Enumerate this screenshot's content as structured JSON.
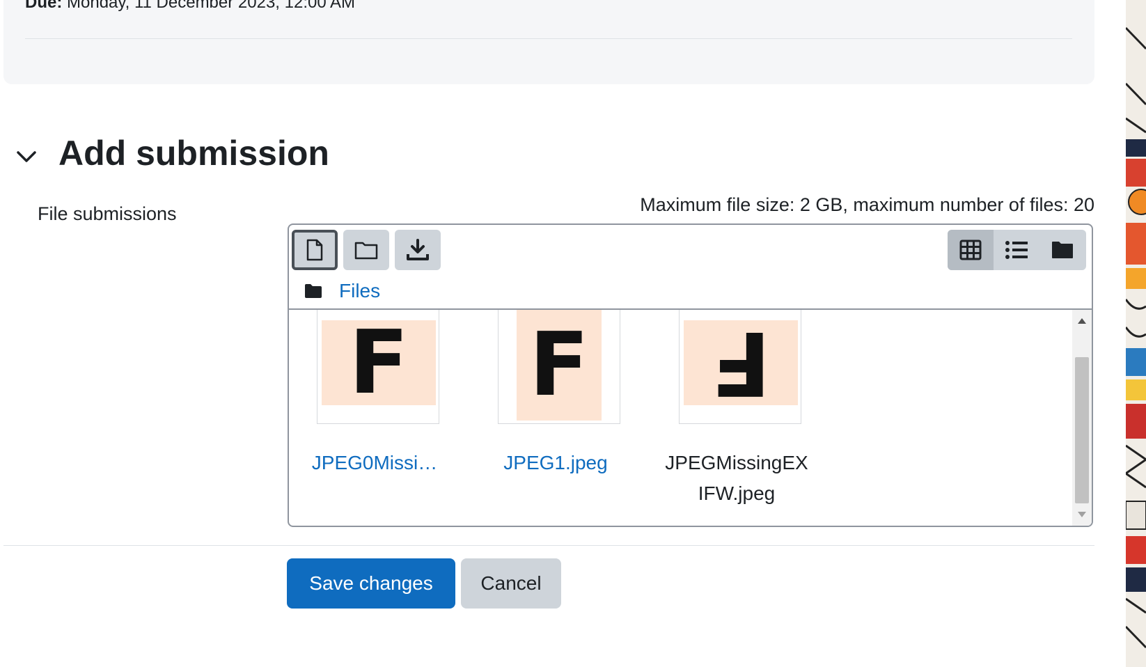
{
  "dates": {
    "due_label": "Due:",
    "due_value": "Monday, 11 December 2023, 12:00 AM"
  },
  "section": {
    "title": "Add submission",
    "toggle_icon": "chevron-down-icon"
  },
  "field": {
    "label": "File submissions",
    "limits": "Maximum file size: 2 GB, maximum number of files: 20"
  },
  "filemanager": {
    "toolbar": {
      "add_file_icon": "file-icon",
      "create_folder_icon": "folder-outline-icon",
      "download_icon": "download-icon",
      "views": [
        {
          "icon": "grid-icon",
          "selected": true
        },
        {
          "icon": "list-icon",
          "selected": false
        },
        {
          "icon": "folder-icon",
          "selected": false
        }
      ]
    },
    "path": {
      "icon": "folder-icon",
      "label": "Files"
    },
    "files": [
      {
        "name": "JPEG0Missi…",
        "glyph": "F",
        "orientation": "normal",
        "link": true
      },
      {
        "name": "JPEG1.jpeg",
        "glyph": "F",
        "orientation": "normal",
        "link": true
      },
      {
        "name": "JPEGMissingEXIFW.jpeg",
        "glyph": "F",
        "orientation": "rotated",
        "link": false
      }
    ]
  },
  "actions": {
    "save_label": "Save changes",
    "cancel_label": "Cancel"
  },
  "colors": {
    "primary": "#0f6cbf",
    "secondary": "#ced4da",
    "thumb_bg": "#fde4d3"
  }
}
